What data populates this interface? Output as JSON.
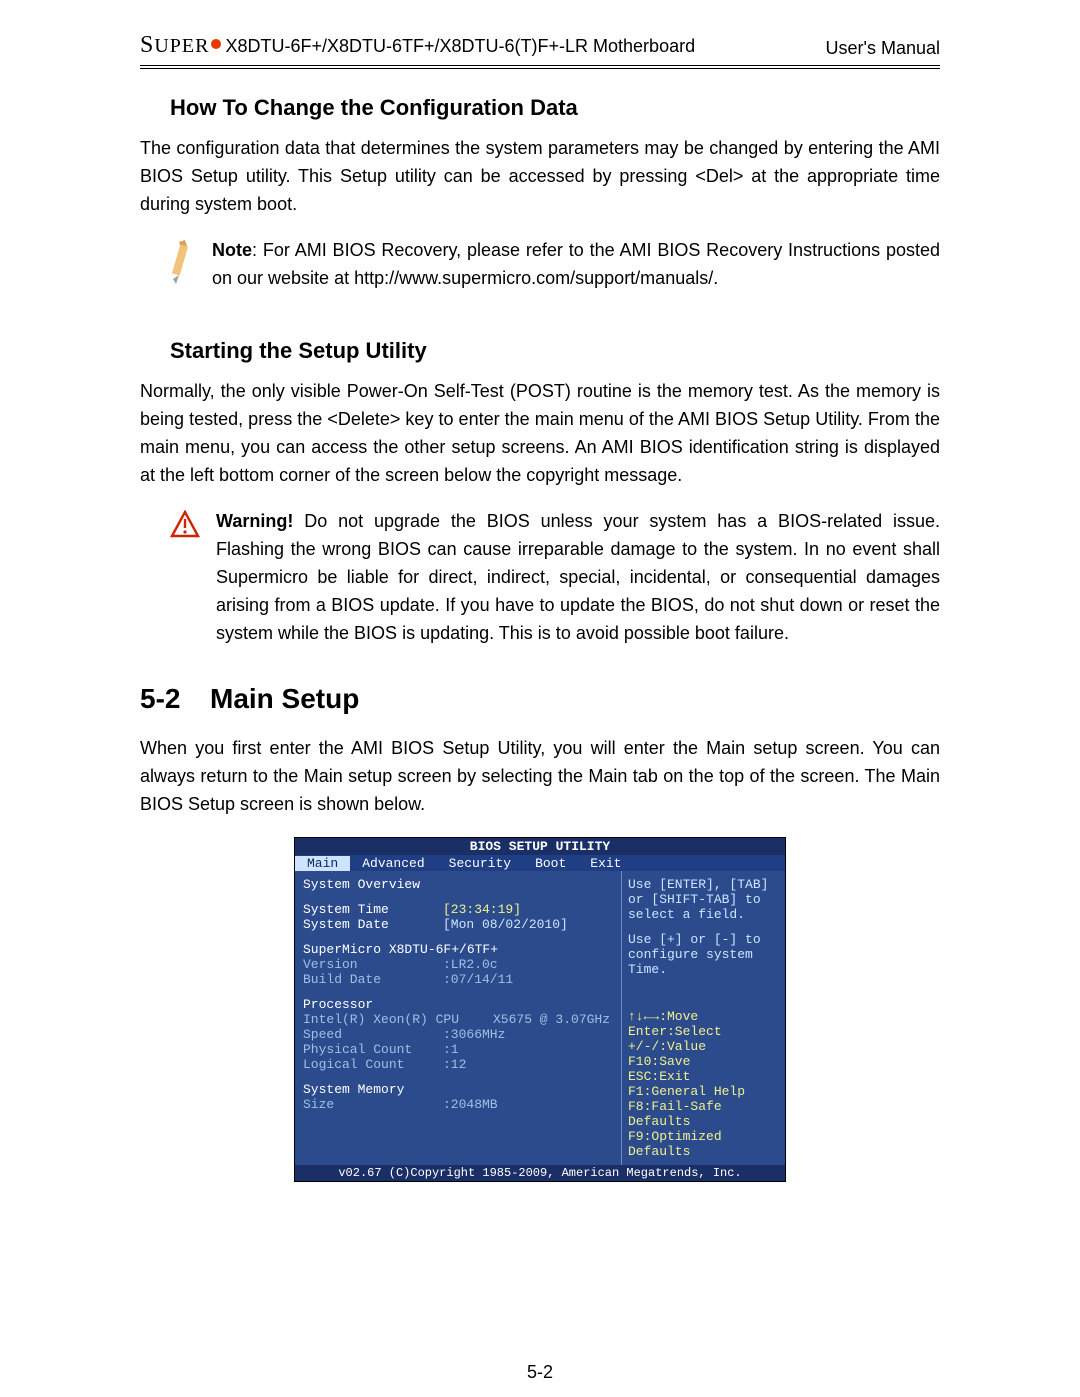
{
  "header": {
    "logo_text": "SUPER",
    "model": "X8DTU-6F+/X8DTU-6TF+/X8DTU-6(T)F+-LR Motherboard",
    "doc": "User's Manual"
  },
  "section1": {
    "title": "How To Change the Configuration Data",
    "body": "The configuration data that determines the system parameters may be changed by entering the  AMI BIOS Setup utility. This Setup utility can be accessed by pressing <Del> at the appropriate time during system boot.",
    "note_bold": "Note",
    "note": ": For AMI BIOS Recovery, please refer to the AMI BIOS Recovery Instructions posted on our website at http://www.supermicro.com/support/manuals/."
  },
  "section2": {
    "title": "Starting the Setup Utility",
    "body": "Normally, the only visible Power-On Self-Test (POST) routine is the memory test. As the memory is being tested, press the <Delete> key to enter the main menu of the AMI BIOS Setup Utility. From the main menu, you can access the other setup screens. An AMI BIOS identification string is displayed at the left bottom corner of the screen below the copyright message.",
    "warn_bold": "Warning!",
    "warn": " Do not upgrade the BIOS unless your system has a BIOS-related issue. Flashing the wrong BIOS can cause irreparable damage to the system. In no event shall Supermicro be liable for direct, indirect, special, incidental, or consequential damages arising from a BIOS update. If you have to update the BIOS, do not shut down or reset the system while the BIOS is updating. This is to avoid possible boot failure."
  },
  "section3": {
    "num": "5-2",
    "title": "Main Setup",
    "body": "When you first enter the AMI BIOS Setup Utility, you will enter the Main setup screen. You can always return to the Main setup screen by selecting the Main tab on the top of the screen. The Main BIOS Setup screen is shown below."
  },
  "bios": {
    "title": "BIOS SETUP UTILITY",
    "tabs": [
      "Main",
      "Advanced",
      "Security",
      "Boot",
      "Exit"
    ],
    "left": {
      "overview": "System Overview",
      "time_lbl": "System Time",
      "time_val": "[23:34:19]",
      "date_lbl": "System Date",
      "date_val": "[Mon 08/02/2010]",
      "board": "SuperMicro X8DTU-6F+/6TF+",
      "ver_lbl": "Version",
      "ver_val": ":LR2.0c",
      "build_lbl": "Build Date",
      "build_val": ":07/14/11",
      "proc": "Processor",
      "cpu_model": "Intel(R) Xeon(R) CPU",
      "cpu_sku": "X5675  @ 3.07GHz",
      "speed_lbl": "Speed",
      "speed_val": ":3066MHz",
      "phys_lbl": "Physical Count",
      "phys_val": ":1",
      "log_lbl": "Logical Count",
      "log_val": ":12",
      "mem": "System Memory",
      "size_lbl": "Size",
      "size_val": ":2048MB"
    },
    "right_top": [
      "Use [ENTER], [TAB]",
      "or [SHIFT-TAB] to",
      "select a field.",
      "",
      "Use [+] or [-] to",
      "configure system Time."
    ],
    "right_bottom": [
      "↑↓←→:Move",
      "Enter:Select",
      "+/-/:Value",
      "F10:Save",
      "ESC:Exit",
      "F1:General Help",
      "F8:Fail-Safe Defaults",
      "F9:Optimized Defaults"
    ],
    "footer": "v02.67 (C)Copyright 1985-2009, American Megatrends, Inc."
  },
  "page_num": "5-2"
}
